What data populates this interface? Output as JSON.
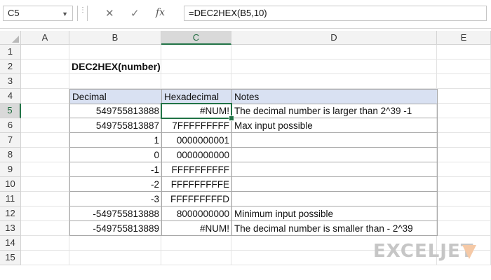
{
  "formula_bar": {
    "name_box": "C5",
    "cancel_icon": "✕",
    "enter_icon": "✓",
    "fx_label": "fx",
    "formula": "=DEC2HEX(B5,10)"
  },
  "columns": [
    "A",
    "B",
    "C",
    "D",
    "E"
  ],
  "rows": [
    "1",
    "2",
    "3",
    "4",
    "5",
    "6",
    "7",
    "8",
    "9",
    "10",
    "11",
    "12",
    "13",
    "14",
    "15"
  ],
  "sheet": {
    "title": "DEC2HEX(number)",
    "headers": {
      "decimal": "Decimal",
      "hex": "Hexadecimal",
      "notes": "Notes"
    },
    "data": [
      {
        "decimal": "549755813888",
        "hex": "#NUM!",
        "notes": "The decimal number is larger than 2^39 -1"
      },
      {
        "decimal": "549755813887",
        "hex": "7FFFFFFFFF",
        "notes": "Max input possible"
      },
      {
        "decimal": "1",
        "hex": "0000000001",
        "notes": ""
      },
      {
        "decimal": "0",
        "hex": "0000000000",
        "notes": ""
      },
      {
        "decimal": "-1",
        "hex": "FFFFFFFFFF",
        "notes": ""
      },
      {
        "decimal": "-2",
        "hex": "FFFFFFFFFE",
        "notes": ""
      },
      {
        "decimal": "-3",
        "hex": "FFFFFFFFFD",
        "notes": ""
      },
      {
        "decimal": "-549755813888",
        "hex": "8000000000",
        "notes": "Minimum input possible"
      },
      {
        "decimal": "-549755813889",
        "hex": "#NUM!",
        "notes": "The decimal number is smaller than - 2^39"
      }
    ]
  },
  "logo": {
    "text": "EXCELJET",
    "color": "#c6c6c6",
    "mark_color": "#f5c9a6"
  },
  "accent_color": "#217346",
  "header_fill": "#d9e1f2"
}
